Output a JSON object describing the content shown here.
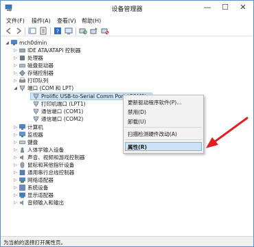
{
  "window": {
    "title": "设备管理器",
    "minimize": "—",
    "maximize": "☐",
    "close": "✕"
  },
  "menubar": {
    "items": [
      "文件(F)",
      "操作(A)",
      "查看(V)",
      "帮助(H)"
    ]
  },
  "tree": {
    "root": "mch0dmin",
    "nodes": [
      "IDE ATA/ATAPI 控制器",
      "处理器",
      "磁盘驱动器",
      "存储控制器",
      "打印队列",
      "端口 (COM 和 LPT)",
      "Prolific USB-to-Serial Comm Port (COM3)",
      "打印机端口 (LPT1)",
      "通信端口 (COM1)",
      "通信端口 (COM2)",
      "计算机",
      "监视器",
      "键盘",
      "人体学输入设备",
      "声音、视频和游戏控制器",
      "鼠标和其他指针设备",
      "通用串行总线控制器",
      "网络适配器",
      "系统设备",
      "显示适配器",
      "音频输入和输出"
    ]
  },
  "context_menu": {
    "items": [
      "更新驱动程序软件(P)...",
      "禁用(D)",
      "卸载(U)",
      "扫描检测硬件改动(A)",
      "属性(R)"
    ]
  },
  "status": {
    "text": "为当前的选择打开属性页。"
  },
  "colors": {
    "selection": "#cce4f7",
    "menu_highlight": "#cfe3f7",
    "arrow": "#e02020"
  }
}
